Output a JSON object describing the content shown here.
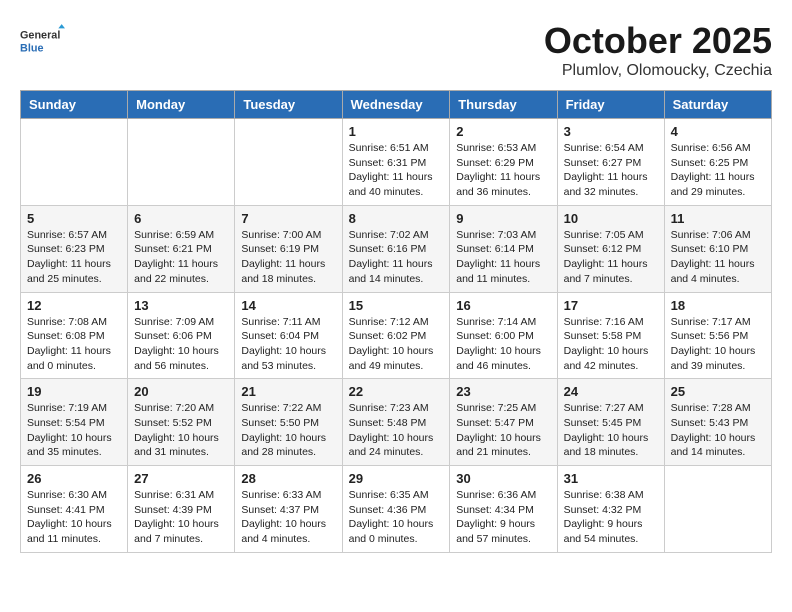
{
  "header": {
    "logo_line1": "General",
    "logo_line2": "Blue",
    "month": "October 2025",
    "location": "Plumlov, Olomoucky, Czechia"
  },
  "weekdays": [
    "Sunday",
    "Monday",
    "Tuesday",
    "Wednesday",
    "Thursday",
    "Friday",
    "Saturday"
  ],
  "weeks": [
    [
      {
        "day": "",
        "info": ""
      },
      {
        "day": "",
        "info": ""
      },
      {
        "day": "",
        "info": ""
      },
      {
        "day": "1",
        "info": "Sunrise: 6:51 AM\nSunset: 6:31 PM\nDaylight: 11 hours\nand 40 minutes."
      },
      {
        "day": "2",
        "info": "Sunrise: 6:53 AM\nSunset: 6:29 PM\nDaylight: 11 hours\nand 36 minutes."
      },
      {
        "day": "3",
        "info": "Sunrise: 6:54 AM\nSunset: 6:27 PM\nDaylight: 11 hours\nand 32 minutes."
      },
      {
        "day": "4",
        "info": "Sunrise: 6:56 AM\nSunset: 6:25 PM\nDaylight: 11 hours\nand 29 minutes."
      }
    ],
    [
      {
        "day": "5",
        "info": "Sunrise: 6:57 AM\nSunset: 6:23 PM\nDaylight: 11 hours\nand 25 minutes."
      },
      {
        "day": "6",
        "info": "Sunrise: 6:59 AM\nSunset: 6:21 PM\nDaylight: 11 hours\nand 22 minutes."
      },
      {
        "day": "7",
        "info": "Sunrise: 7:00 AM\nSunset: 6:19 PM\nDaylight: 11 hours\nand 18 minutes."
      },
      {
        "day": "8",
        "info": "Sunrise: 7:02 AM\nSunset: 6:16 PM\nDaylight: 11 hours\nand 14 minutes."
      },
      {
        "day": "9",
        "info": "Sunrise: 7:03 AM\nSunset: 6:14 PM\nDaylight: 11 hours\nand 11 minutes."
      },
      {
        "day": "10",
        "info": "Sunrise: 7:05 AM\nSunset: 6:12 PM\nDaylight: 11 hours\nand 7 minutes."
      },
      {
        "day": "11",
        "info": "Sunrise: 7:06 AM\nSunset: 6:10 PM\nDaylight: 11 hours\nand 4 minutes."
      }
    ],
    [
      {
        "day": "12",
        "info": "Sunrise: 7:08 AM\nSunset: 6:08 PM\nDaylight: 11 hours\nand 0 minutes."
      },
      {
        "day": "13",
        "info": "Sunrise: 7:09 AM\nSunset: 6:06 PM\nDaylight: 10 hours\nand 56 minutes."
      },
      {
        "day": "14",
        "info": "Sunrise: 7:11 AM\nSunset: 6:04 PM\nDaylight: 10 hours\nand 53 minutes."
      },
      {
        "day": "15",
        "info": "Sunrise: 7:12 AM\nSunset: 6:02 PM\nDaylight: 10 hours\nand 49 minutes."
      },
      {
        "day": "16",
        "info": "Sunrise: 7:14 AM\nSunset: 6:00 PM\nDaylight: 10 hours\nand 46 minutes."
      },
      {
        "day": "17",
        "info": "Sunrise: 7:16 AM\nSunset: 5:58 PM\nDaylight: 10 hours\nand 42 minutes."
      },
      {
        "day": "18",
        "info": "Sunrise: 7:17 AM\nSunset: 5:56 PM\nDaylight: 10 hours\nand 39 minutes."
      }
    ],
    [
      {
        "day": "19",
        "info": "Sunrise: 7:19 AM\nSunset: 5:54 PM\nDaylight: 10 hours\nand 35 minutes."
      },
      {
        "day": "20",
        "info": "Sunrise: 7:20 AM\nSunset: 5:52 PM\nDaylight: 10 hours\nand 31 minutes."
      },
      {
        "day": "21",
        "info": "Sunrise: 7:22 AM\nSunset: 5:50 PM\nDaylight: 10 hours\nand 28 minutes."
      },
      {
        "day": "22",
        "info": "Sunrise: 7:23 AM\nSunset: 5:48 PM\nDaylight: 10 hours\nand 24 minutes."
      },
      {
        "day": "23",
        "info": "Sunrise: 7:25 AM\nSunset: 5:47 PM\nDaylight: 10 hours\nand 21 minutes."
      },
      {
        "day": "24",
        "info": "Sunrise: 7:27 AM\nSunset: 5:45 PM\nDaylight: 10 hours\nand 18 minutes."
      },
      {
        "day": "25",
        "info": "Sunrise: 7:28 AM\nSunset: 5:43 PM\nDaylight: 10 hours\nand 14 minutes."
      }
    ],
    [
      {
        "day": "26",
        "info": "Sunrise: 6:30 AM\nSunset: 4:41 PM\nDaylight: 10 hours\nand 11 minutes."
      },
      {
        "day": "27",
        "info": "Sunrise: 6:31 AM\nSunset: 4:39 PM\nDaylight: 10 hours\nand 7 minutes."
      },
      {
        "day": "28",
        "info": "Sunrise: 6:33 AM\nSunset: 4:37 PM\nDaylight: 10 hours\nand 4 minutes."
      },
      {
        "day": "29",
        "info": "Sunrise: 6:35 AM\nSunset: 4:36 PM\nDaylight: 10 hours\nand 0 minutes."
      },
      {
        "day": "30",
        "info": "Sunrise: 6:36 AM\nSunset: 4:34 PM\nDaylight: 9 hours\nand 57 minutes."
      },
      {
        "day": "31",
        "info": "Sunrise: 6:38 AM\nSunset: 4:32 PM\nDaylight: 9 hours\nand 54 minutes."
      },
      {
        "day": "",
        "info": ""
      }
    ]
  ]
}
